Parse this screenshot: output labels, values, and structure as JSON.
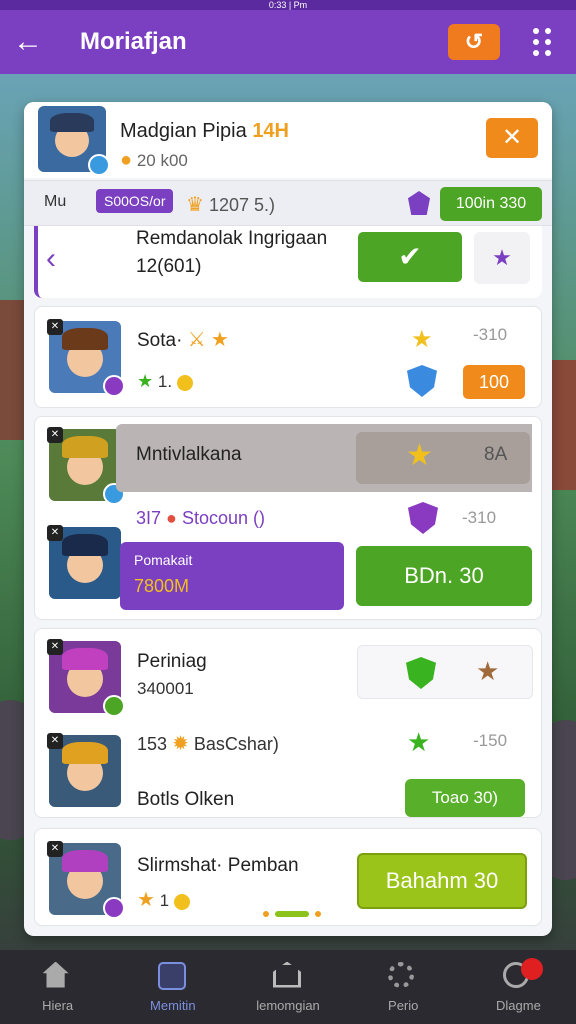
{
  "status_bar": {
    "text": "0:33 | Pm"
  },
  "app_bar": {
    "title": "Moriafjan",
    "power_label": "↺"
  },
  "header": {
    "name": "Madgian Pipia",
    "level": "14H",
    "coins": "20 k00"
  },
  "stats": {
    "label": "Mu",
    "tag": "S00OS/or",
    "value": "1207  5.)",
    "button": "100in 330"
  },
  "quest": {
    "title": "Remdanolak Ingrigaan",
    "sub": "12(601)"
  },
  "rows": [
    {
      "name": "Sota·",
      "sub": "1.",
      "cost": "-310",
      "button": "100"
    },
    {
      "name": "Mntivlalkana",
      "value": "8A"
    },
    {
      "name": "3I7",
      "sub": "Stocoun ()",
      "cost": "-310",
      "label": "Pomakait",
      "amount": "7800M",
      "button": "BDn. 30"
    },
    {
      "name": "Periniag",
      "sub": "340001",
      "cost": "-150"
    },
    {
      "name": "153",
      "sub": "BasCshar)"
    },
    {
      "name": "Botls Olken",
      "button": "Toao 30)"
    },
    {
      "name": "Slirmshat· Pemban",
      "sub": "1",
      "button": "Bahahm 30"
    }
  ],
  "nav": [
    {
      "label": "Hiera",
      "icon": "home-icon"
    },
    {
      "label": "Memitin",
      "icon": "box-icon"
    },
    {
      "label": "lemomgian",
      "icon": "house-icon"
    },
    {
      "label": "Perio",
      "icon": "gear-icon"
    },
    {
      "label": "Dlagme",
      "icon": "notification-icon"
    }
  ],
  "colors": {
    "primary": "#7b3fc1",
    "accent": "#f08a1a",
    "success": "#4ca524"
  }
}
